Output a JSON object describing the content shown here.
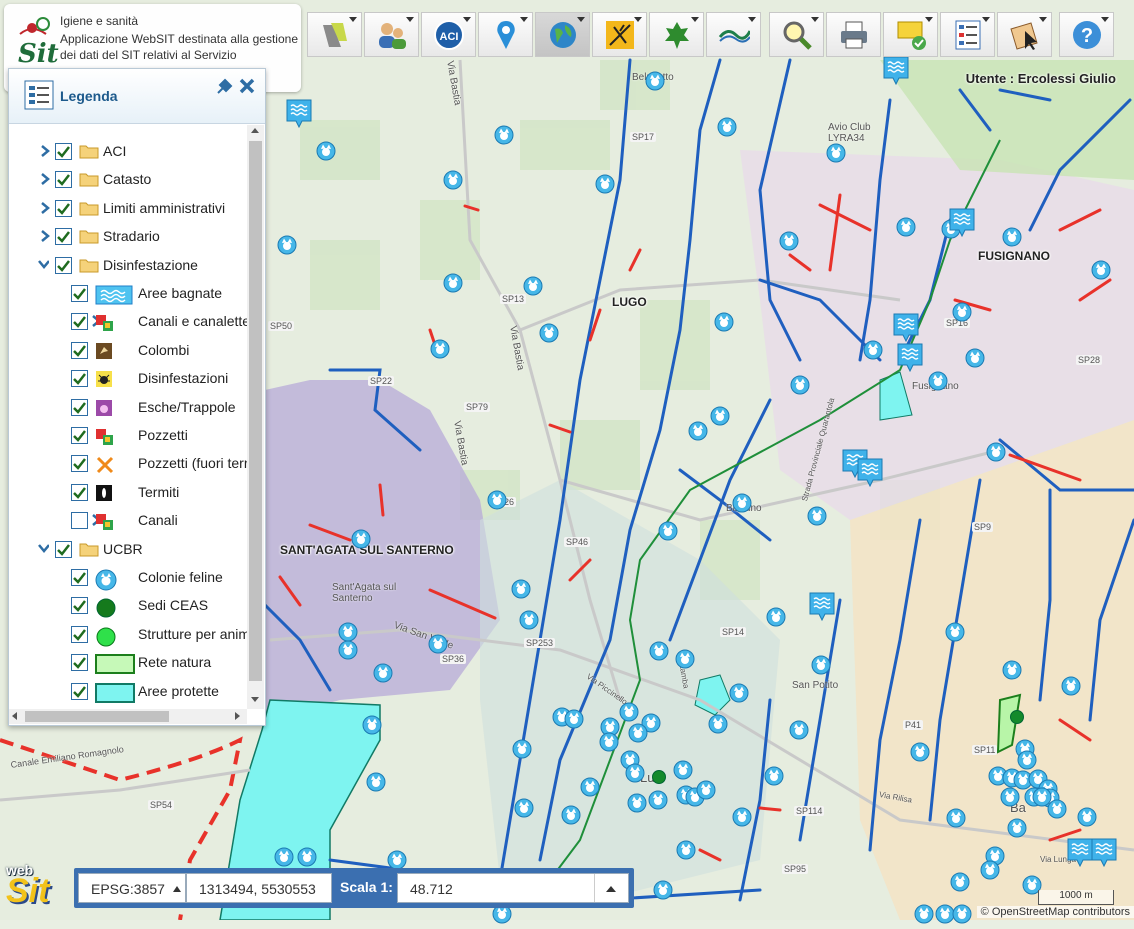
{
  "app": {
    "title": "Igiene e sanità",
    "description": "Applicazione WebSIT destinata alla gestione dei dati del SIT relativi al Servizio",
    "logo_text": "Sit",
    "user_label": "Utente : Ercolessi Giulio"
  },
  "toolbar": {
    "buttons": [
      {
        "name": "layers-tool",
        "icon": "road-layers-icon"
      },
      {
        "name": "users-tool",
        "icon": "users-icon"
      },
      {
        "name": "aci-tool",
        "icon": "aci-icon",
        "text": "ACI"
      },
      {
        "name": "locate-tool",
        "icon": "map-pin-icon"
      },
      {
        "name": "basemap-tool",
        "icon": "globe-icon",
        "active": true
      },
      {
        "name": "pest-tool",
        "icon": "mosquito-icon"
      },
      {
        "name": "nature-tool",
        "icon": "leaf-icon"
      },
      {
        "name": "consortium-tool",
        "icon": "wave-logo-icon"
      },
      {
        "name": "search-tool",
        "icon": "magnifier-icon"
      },
      {
        "name": "print-tool",
        "icon": "printer-icon"
      },
      {
        "name": "notes-tool",
        "icon": "note-check-icon"
      },
      {
        "name": "form-tool",
        "icon": "form-list-icon"
      },
      {
        "name": "select-tool",
        "icon": "map-cursor-icon"
      },
      {
        "name": "help-tool",
        "icon": "help-icon",
        "text": "?"
      }
    ]
  },
  "legend": {
    "title": "Legenda",
    "items": [
      {
        "label": "ACI",
        "level": 0,
        "expander": "collapsed",
        "checked": true,
        "symbol": "folder"
      },
      {
        "label": "Catasto",
        "level": 0,
        "expander": "collapsed",
        "checked": true,
        "symbol": "folder"
      },
      {
        "label": "Limiti amministrativi",
        "level": 0,
        "expander": "collapsed",
        "checked": true,
        "symbol": "folder"
      },
      {
        "label": "Stradario",
        "level": 0,
        "expander": "collapsed",
        "checked": true,
        "symbol": "folder"
      },
      {
        "label": "Disinfestazione",
        "level": 0,
        "expander": "expanded",
        "checked": true,
        "symbol": "folder"
      },
      {
        "label": "Aree bagnate",
        "level": 1,
        "expander": "none",
        "checked": true,
        "symbol": "water"
      },
      {
        "label": "Canali e canalette",
        "level": 1,
        "expander": "collapsed",
        "checked": true,
        "symbol": "squares"
      },
      {
        "label": "Colombi",
        "level": 1,
        "expander": "none",
        "checked": true,
        "symbol": "pigeon"
      },
      {
        "label": "Disinfestazioni",
        "level": 1,
        "expander": "none",
        "checked": true,
        "symbol": "bug"
      },
      {
        "label": "Esche/Trappole",
        "level": 1,
        "expander": "none",
        "checked": true,
        "symbol": "trap"
      },
      {
        "label": "Pozzetti",
        "level": 1,
        "expander": "none",
        "checked": true,
        "symbol": "squares"
      },
      {
        "label": "Pozzetti (fuori territorio)",
        "level": 1,
        "expander": "none",
        "checked": true,
        "symbol": "cross"
      },
      {
        "label": "Termiti",
        "level": 1,
        "expander": "none",
        "checked": true,
        "symbol": "termite"
      },
      {
        "label": "Canali",
        "level": 1,
        "expander": "collapsed",
        "checked": false,
        "symbol": "squares"
      },
      {
        "label": "UCBR",
        "level": 0,
        "expander": "expanded",
        "checked": true,
        "symbol": "folder"
      },
      {
        "label": "Colonie feline",
        "level": 1,
        "expander": "none",
        "checked": true,
        "symbol": "cat"
      },
      {
        "label": "Sedi CEAS",
        "level": 1,
        "expander": "none",
        "checked": true,
        "symbol": "dark-green-dot"
      },
      {
        "label": "Strutture per animali",
        "level": 1,
        "expander": "none",
        "checked": true,
        "symbol": "green-dot"
      },
      {
        "label": "Rete natura",
        "level": 1,
        "expander": "none",
        "checked": true,
        "symbol": "green-rect"
      },
      {
        "label": "Aree protette",
        "level": 1,
        "expander": "none",
        "checked": true,
        "symbol": "cyan-rect"
      }
    ]
  },
  "map": {
    "towns": [
      "LUGO",
      "FUSIGNANO",
      "SANT'AGATA SUL SANTERNO"
    ],
    "places": [
      "Belricetto",
      "Fusignano",
      "Bizzuno",
      "Sant'Agata sul Santerno",
      "San Potito",
      "Avio Club LYRA34",
      "Ba",
      "Lu"
    ],
    "roads": [
      "SP17",
      "SP13",
      "SP79",
      "SP26",
      "SP46",
      "SP253",
      "SP14",
      "SP36",
      "SP50",
      "SP22",
      "SP28",
      "SP9",
      "SP114",
      "SP95",
      "SP54",
      "P41",
      "SP11",
      "SP16"
    ],
    "streets": [
      "Via Bastia",
      "Via Bastia",
      "Via Bastia",
      "Via San Vitale",
      "Strada Provinciale Quarantola",
      "Via Piccinello",
      "Via Lamba",
      "Via Rilisa",
      "Canale Emiliano Romagnolo",
      "Via Lunga"
    ]
  },
  "coords": {
    "epsg": "EPSG:3857",
    "value": "1313494, 5530553",
    "scale_label": "Scala 1:",
    "scale_value": "48.712"
  },
  "scalebar": "1000 m",
  "attribution": "© OpenStreetMap contributors",
  "websit_logo": {
    "top": "web",
    "bottom": "Sit"
  },
  "colors": {
    "accent": "#3b6fb0",
    "canal": "#1f5fbf",
    "red_line": "#e8322a",
    "protected": "#7ef4f0",
    "cat_marker": "#46b7e8"
  }
}
